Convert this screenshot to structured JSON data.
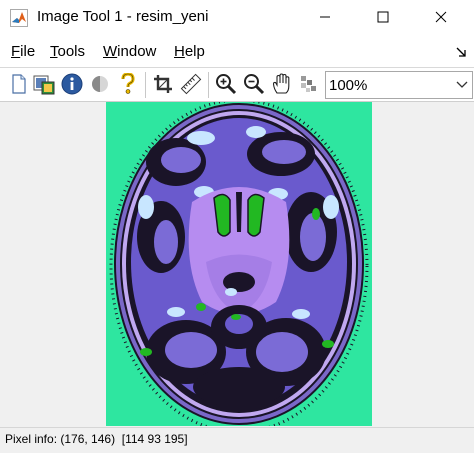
{
  "window": {
    "title": "Image Tool 1 - resim_yeni",
    "app_icon": "matlab-icon",
    "controls": [
      "minimize-icon",
      "maximize-icon",
      "close-icon"
    ]
  },
  "menu": {
    "file": {
      "mnemonic": "F",
      "rest": "ile"
    },
    "tools": {
      "mnemonic": "T",
      "rest": "ools"
    },
    "window": {
      "mnemonic": "W",
      "rest": "indow"
    },
    "help": {
      "mnemonic": "H",
      "rest": "elp"
    }
  },
  "toolbar": {
    "icons": [
      "new-figure-icon",
      "image-window-icon",
      "info-icon",
      "contrast-icon",
      "help-icon",
      "crop-icon",
      "measure-distance-icon",
      "zoom-in-icon",
      "zoom-out-icon",
      "pan-hand-icon",
      "pixel-region-icon"
    ],
    "zoom_value": "100%"
  },
  "colors": {
    "background_cyan": "#2ee6a0",
    "tissue_purple": "#6a5acd",
    "light_violet": "#b68cf0",
    "pale_blue": "#c8e6ff",
    "dark": "#1a1428",
    "green": "#22b822"
  },
  "status": {
    "pixel_info": "Pixel info: (176, 146)  [114 93 195]"
  }
}
